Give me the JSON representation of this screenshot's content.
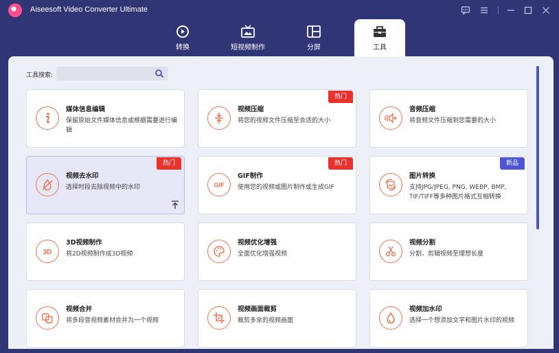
{
  "app": {
    "title": "Aiseesoft Video Converter Ultimate",
    "icons": [
      "feedback-icon",
      "menu-icon",
      "minimize-icon",
      "maximize-icon",
      "close-icon"
    ]
  },
  "nav": {
    "tabs": [
      {
        "label": "转换",
        "icon": "convert-icon",
        "active": false
      },
      {
        "label": "短视频制作",
        "icon": "mv-icon",
        "active": false
      },
      {
        "label": "分屏",
        "icon": "collage-icon",
        "active": false
      },
      {
        "label": "工具",
        "icon": "toolbox-icon",
        "active": true
      }
    ]
  },
  "search": {
    "label": "工具搜索:",
    "value": "",
    "placeholder": ""
  },
  "cards": [
    {
      "title": "媒体信息编辑",
      "desc": "保留原始文件媒体信息或根据需要进行编辑",
      "icon": "info-icon",
      "badge": ""
    },
    {
      "title": "视频压缩",
      "desc": "将您的视频文件压缩至合适的大小",
      "icon": "compress-icon",
      "badge": "热门"
    },
    {
      "title": "音频压缩",
      "desc": "将音频文件压缩到您需要的大小",
      "icon": "audio-compress-icon",
      "badge": ""
    },
    {
      "title": "视频去水印",
      "desc": "选择时段去除视频中的水印",
      "icon": "watermark-remove-icon",
      "badge": "热门"
    },
    {
      "title": "GIF制作",
      "desc": "使用您的视频或图片制作或生成GIF",
      "icon": "gif-icon",
      "badge": "热门"
    },
    {
      "title": "图片转换",
      "desc": "支持JPG/JPEG, PNG, WEBP, BMP, TIF/TIFF等多种图片格式互相转换",
      "icon": "image-convert-icon",
      "badge": "新品"
    },
    {
      "title": "3D视频制作",
      "desc": "将2D视频制作成3D视频",
      "icon": "3d-icon",
      "badge": ""
    },
    {
      "title": "视频优化增强",
      "desc": "全面优化增强视频",
      "icon": "palette-icon",
      "badge": ""
    },
    {
      "title": "视频分割",
      "desc": "分割、剪辑视频至理想长度",
      "icon": "scissors-icon",
      "badge": ""
    },
    {
      "title": "视频合并",
      "desc": "将多段音视频素材合并为一个视频",
      "icon": "merge-icon",
      "badge": ""
    },
    {
      "title": "视频画面裁剪",
      "desc": "裁剪多余的视频画面",
      "icon": "crop-icon",
      "badge": ""
    },
    {
      "title": "视频加水印",
      "desc": "选择一个想添加文字和图片水印的视频",
      "icon": "watermark-add-icon",
      "badge": ""
    }
  ],
  "colors": {
    "accent": "#f0734f",
    "hot_badge": "#e8322b",
    "new_badge": "#4d55d6",
    "titlebar_bg": "#2f3575"
  }
}
